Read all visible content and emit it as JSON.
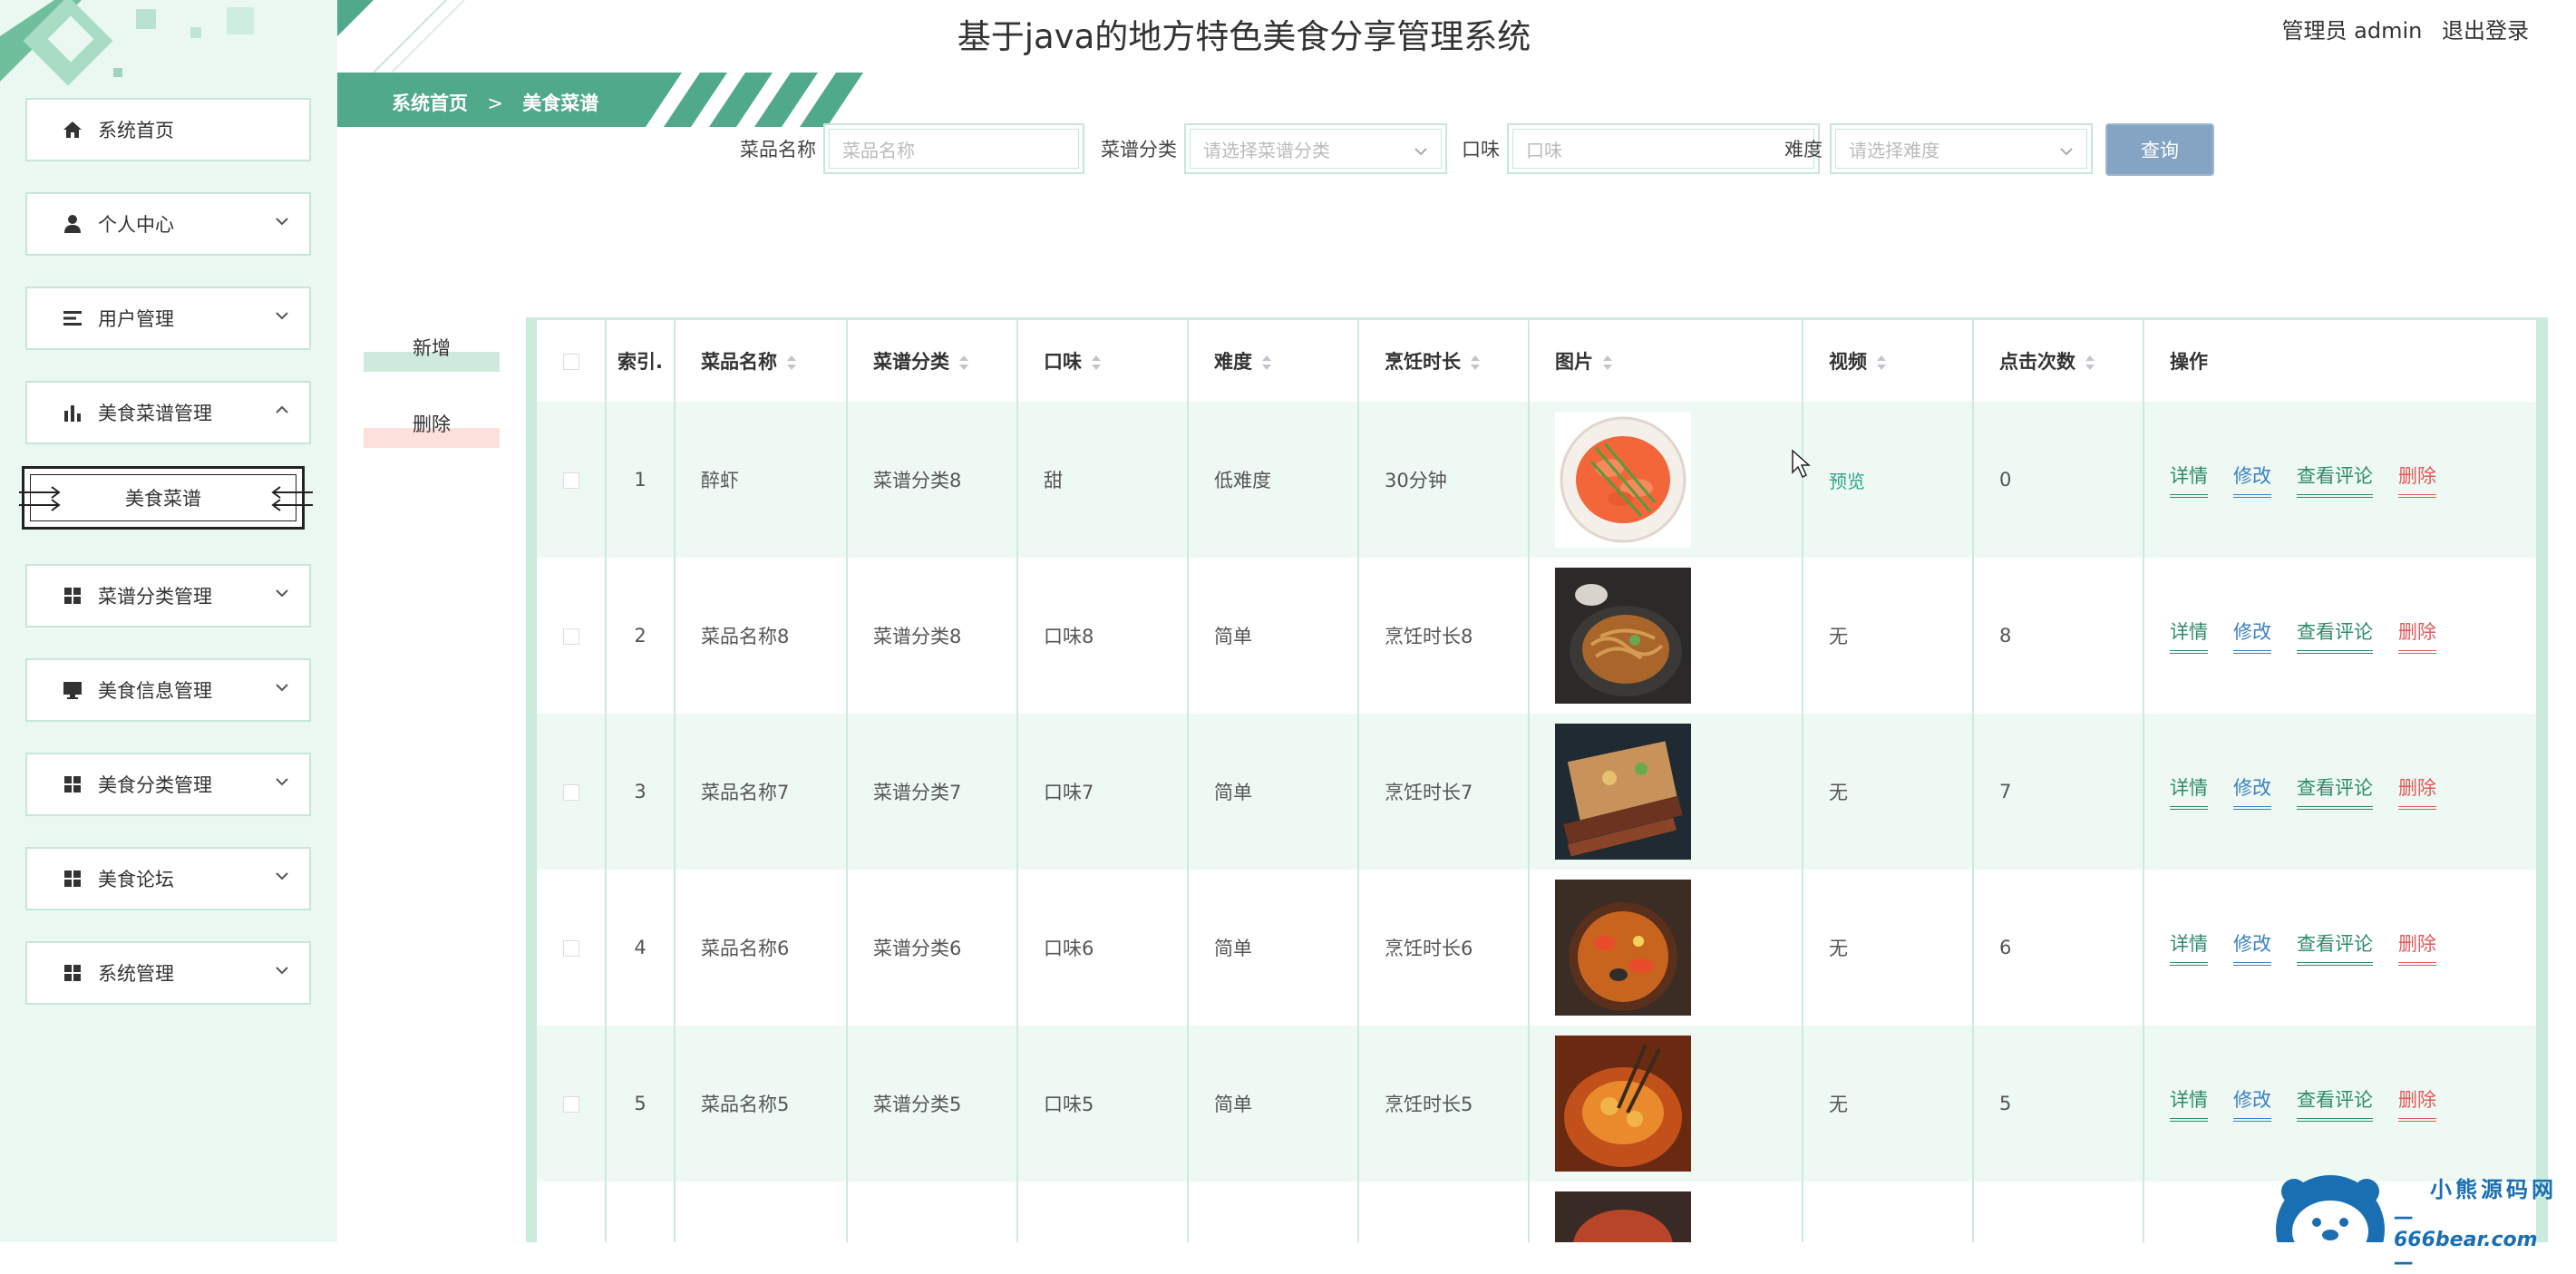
{
  "header": {
    "title": "基于java的地方特色美食分享管理系统",
    "admin_label": "管理员 admin",
    "logout_label": "退出登录"
  },
  "breadcrumb": {
    "home": "系统首页",
    "separator": ">",
    "current": "美食菜谱"
  },
  "sidebar": {
    "items": [
      {
        "label": "系统首页",
        "icon": "home-icon"
      },
      {
        "label": "个人中心",
        "icon": "user-icon"
      },
      {
        "label": "用户管理",
        "icon": "list-icon"
      },
      {
        "label": "美食菜谱管理",
        "icon": "bar-chart-icon",
        "expanded": true
      },
      {
        "label": "菜谱分类管理",
        "icon": "grid-icon"
      },
      {
        "label": "美食信息管理",
        "icon": "monitor-icon"
      },
      {
        "label": "美食分类管理",
        "icon": "grid-icon"
      },
      {
        "label": "美食论坛",
        "icon": "grid-icon"
      },
      {
        "label": "系统管理",
        "icon": "grid-icon"
      }
    ],
    "submenu_active": "美食菜谱"
  },
  "search": {
    "name_label": "菜品名称",
    "name_placeholder": "菜品名称",
    "category_label": "菜谱分类",
    "category_placeholder": "请选择菜谱分类",
    "taste_label": "口味",
    "taste_placeholder": "口味",
    "difficulty_label": "难度",
    "difficulty_placeholder": "请选择难度",
    "query_button": "查询"
  },
  "actions": {
    "add": "新增",
    "delete": "删除"
  },
  "table": {
    "headers": {
      "index": "索引.",
      "name": "菜品名称",
      "category": "菜谱分类",
      "taste": "口味",
      "difficulty": "难度",
      "duration": "烹饪时长",
      "image": "图片",
      "video": "视频",
      "clicks": "点击次数",
      "ops": "操作"
    },
    "ops": {
      "detail": "详情",
      "edit": "修改",
      "comment": "查看评论",
      "delete": "删除"
    },
    "rows": [
      {
        "index": "1",
        "name": "醉虾",
        "category": "菜谱分类8",
        "taste": "甜",
        "difficulty": "低难度",
        "duration": "30分钟",
        "video": "预览",
        "clicks": "0"
      },
      {
        "index": "2",
        "name": "菜品名称8",
        "category": "菜谱分类8",
        "taste": "口味8",
        "difficulty": "简单",
        "duration": "烹饪时长8",
        "video": "无",
        "clicks": "8"
      },
      {
        "index": "3",
        "name": "菜品名称7",
        "category": "菜谱分类7",
        "taste": "口味7",
        "difficulty": "简单",
        "duration": "烹饪时长7",
        "video": "无",
        "clicks": "7"
      },
      {
        "index": "4",
        "name": "菜品名称6",
        "category": "菜谱分类6",
        "taste": "口味6",
        "difficulty": "简单",
        "duration": "烹饪时长6",
        "video": "无",
        "clicks": "6"
      },
      {
        "index": "5",
        "name": "菜品名称5",
        "category": "菜谱分类5",
        "taste": "口味5",
        "difficulty": "简单",
        "duration": "烹饪时长5",
        "video": "无",
        "clicks": "5"
      }
    ]
  },
  "watermark": {
    "name": "小熊源码网",
    "url": "—666bear.com—"
  },
  "colors": {
    "accent": "#4fa98a",
    "sidebar_bg": "#eaf8f1",
    "query_button": "#85a4c4",
    "delete": "#e05a5a",
    "edit": "#3b7fc4"
  }
}
